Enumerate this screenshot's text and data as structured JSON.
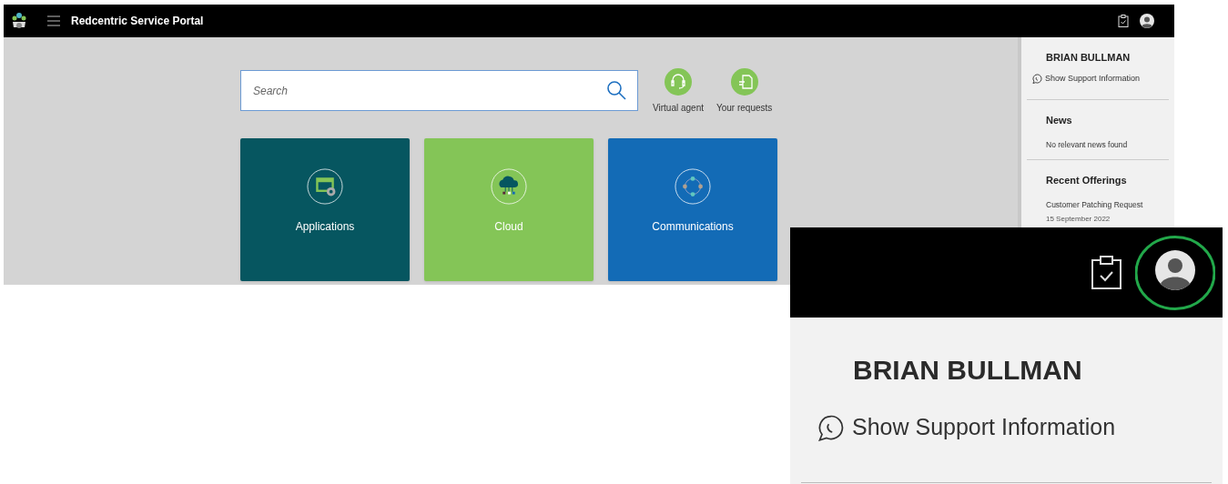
{
  "header": {
    "title": "Redcentric Service Portal"
  },
  "search": {
    "placeholder": "Search"
  },
  "quick_links": [
    {
      "label": "Virtual agent",
      "kind": "agent"
    },
    {
      "label": "Your requests",
      "kind": "requests"
    }
  ],
  "tiles": [
    {
      "label": "Applications",
      "color": "#065660",
      "kind": "applications"
    },
    {
      "label": "Cloud",
      "color": "#84c557",
      "kind": "cloud"
    },
    {
      "label": "Communications",
      "color": "#136bb6",
      "kind": "communications"
    }
  ],
  "side_panel": {
    "user_name": "BRIAN BULLMAN",
    "support_link": "Show Support Information",
    "sections": [
      {
        "title": "News",
        "items": [
          {
            "text": "No relevant news found"
          }
        ]
      },
      {
        "title": "Recent Offerings",
        "items": [
          {
            "text": "Customer Patching Request",
            "date": "15 September 2022"
          }
        ]
      }
    ]
  },
  "zoom_inset": {
    "user_name": "BRIAN BULLMAN",
    "support_link": "Show Support Information"
  }
}
